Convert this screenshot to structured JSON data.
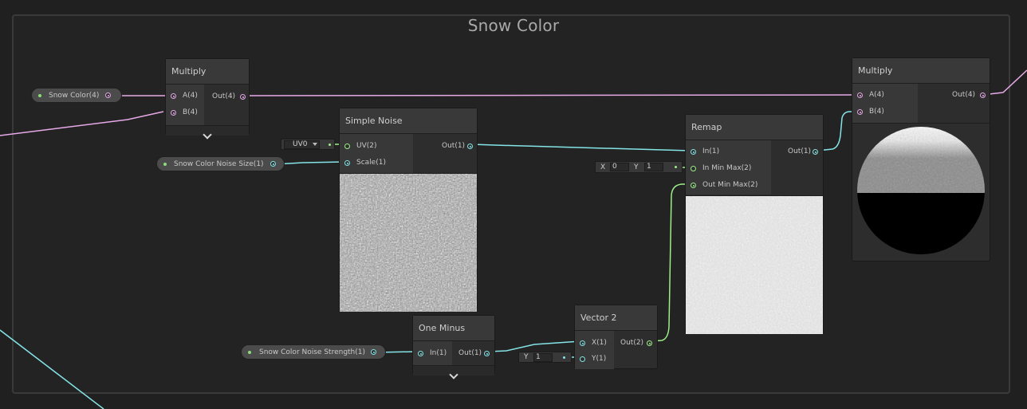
{
  "group": {
    "title": "Snow Color"
  },
  "properties": {
    "snow_color": "Snow Color(4)",
    "noise_size": "Snow Color Noise Size(1)",
    "noise_strength": "Snow Color Noise Strength(1)"
  },
  "nodes": {
    "multiply_left": {
      "title": "Multiply",
      "in_a": "A(4)",
      "in_b": "B(4)",
      "out": "Out(4)"
    },
    "simple_noise": {
      "title": "Simple Noise",
      "in_uv": "UV(2)",
      "in_scale": "Scale(1)",
      "out": "Out(1)",
      "uv_dropdown": "UV0"
    },
    "remap": {
      "title": "Remap",
      "in": "In(1)",
      "in_min_max": "In Min Max(2)",
      "out_min_max": "Out Min Max(2)",
      "out": "Out(1)",
      "in_min_max_x_label": "X",
      "in_min_max_x_value": "0",
      "in_min_max_y_label": "Y",
      "in_min_max_y_value": "1"
    },
    "multiply_right": {
      "title": "Multiply",
      "in_a": "A(4)",
      "in_b": "B(4)",
      "out": "Out(4)"
    },
    "one_minus": {
      "title": "One Minus",
      "in": "In(1)",
      "out": "Out(1)"
    },
    "vector2": {
      "title": "Vector 2",
      "in_x": "X(1)",
      "in_y": "Y(1)",
      "out": "Out(2)",
      "y_field_label": "Y",
      "y_field_value": "1"
    }
  },
  "colors": {
    "vector4_wire": "#e6a9e6",
    "float_wire": "#84e4e7",
    "vector2_wire": "#9cf088"
  }
}
